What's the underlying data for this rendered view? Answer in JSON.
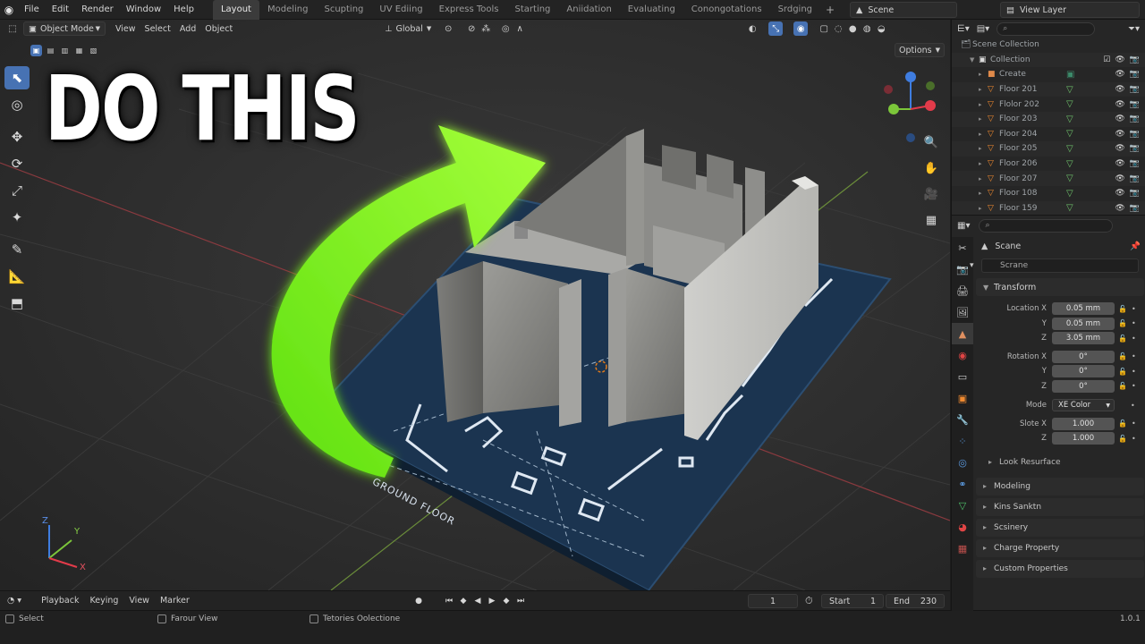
{
  "topbar": {
    "menus": [
      "File",
      "Edit",
      "Render",
      "Window",
      "Help"
    ],
    "workspaces": [
      "Layout",
      "Modeling",
      "Scupting",
      "UV Ediing",
      "Express Tools",
      "Starting",
      "Aniidation",
      "Evaluating",
      "Conongotations",
      "Srdging"
    ],
    "active_workspace": "Layout",
    "scene": "Scene",
    "view_layer": "View Layer"
  },
  "viewport": {
    "mode": "Object Mode",
    "menus": [
      "View",
      "Select",
      "Add",
      "Object"
    ],
    "transform": "Global",
    "options": "Options",
    "overlay_title": "DO THIS",
    "plan_label": "GROUND FLOOR",
    "axis_labels": {
      "x": "X",
      "y": "Y",
      "z": "Z"
    }
  },
  "timeline": {
    "menus": [
      "Playback",
      "Keying",
      "View",
      "Marker"
    ],
    "current_frame": "1",
    "start_label": "Start",
    "start": "1",
    "end_label": "End",
    "end": "230"
  },
  "statusbar": {
    "left": "Select",
    "middle": "Farour View",
    "right_hint": "Tetories Oolectione",
    "version": "1.0.1"
  },
  "outliner": {
    "root": "Scene Collection",
    "collection": "Collection",
    "items": [
      {
        "name": "Create",
        "type": "camera"
      },
      {
        "name": "Floor 201",
        "type": "mesh"
      },
      {
        "name": "Flolor 202",
        "type": "mesh"
      },
      {
        "name": "Floor 203",
        "type": "mesh"
      },
      {
        "name": "Floor 204",
        "type": "mesh"
      },
      {
        "name": "Floor 205",
        "type": "mesh"
      },
      {
        "name": "Floor 206",
        "type": "mesh"
      },
      {
        "name": "Floor 207",
        "type": "mesh"
      },
      {
        "name": "Floor 108",
        "type": "mesh"
      },
      {
        "name": "Floor 159",
        "type": "mesh"
      }
    ]
  },
  "properties": {
    "context": "Scane",
    "name_field": "Scrane",
    "transform_label": "Transform",
    "location_label": "Location X",
    "rotation_label": "Rotation X",
    "location": {
      "x": "0.05 mm",
      "y": "0.05 mm",
      "z": "3.05 mm"
    },
    "rotation": {
      "x": "0°",
      "y": "0°",
      "z": "0°"
    },
    "mode_label": "Mode",
    "mode_value": "XE Color",
    "slote_label": "Slote X",
    "slote": {
      "x": "1.000",
      "z": "1.000"
    },
    "y_label": "Y",
    "z_label": "Z",
    "subpanel": "Look Resurface",
    "collapsed_panels": [
      "Modeling",
      "Kins Sanktn",
      "Scsinery",
      "Charge Property",
      "Custom Properties"
    ]
  },
  "colors": {
    "accent": "#4772b3",
    "arrow": "#7dff1e",
    "plan": "#1b3450",
    "wall": "#8f8f8c",
    "axis_x": "#e23b4a",
    "axis_y": "#7cc63a",
    "axis_z": "#3f7de0"
  }
}
